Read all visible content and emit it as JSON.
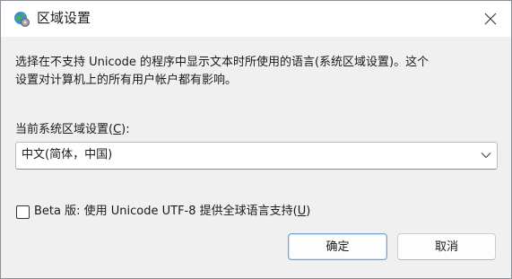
{
  "window": {
    "title": "区域设置",
    "title_icon": "globe-settings-icon",
    "close_icon": "close-icon"
  },
  "description": "选择在不支持 Unicode 的程序中显示文本时所使用的语言(系统区域设置)。这个\n设置对计算机上的所有用户帐户都有影响。",
  "locale": {
    "label": "当前系统区域设置(C):",
    "label_prefix": "当前系统区域设置(",
    "label_accel": "C",
    "label_suffix": "):",
    "selected": "中文(简体，中国)",
    "arrow_icon": "chevron-down-icon"
  },
  "beta": {
    "checked": false,
    "label_prefix": "Beta 版: 使用 Unicode UTF-8 提供全球语言支持(",
    "label_accel": "U",
    "label_suffix": ")"
  },
  "buttons": {
    "ok": "确定",
    "cancel": "取消"
  },
  "colors": {
    "accent": "#7a9fd4",
    "window_bg": "#f0f0f0",
    "titlebar_bg": "#ffffff"
  }
}
